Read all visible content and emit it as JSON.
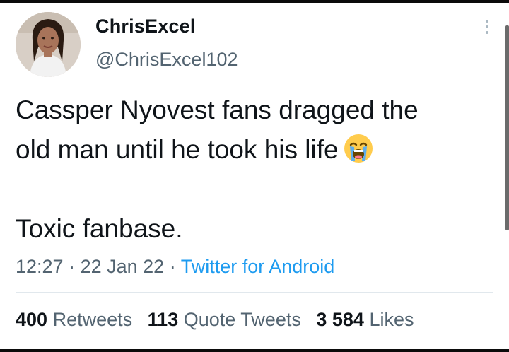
{
  "tweet": {
    "author": {
      "display_name": "ChrisExcel",
      "handle": "@ChrisExcel102"
    },
    "text_line1": "Cassper Nyovest fans dragged the",
    "text_line2": "old man until he took his life",
    "emoji": "loudly-crying-face-icon",
    "text_line3": "Toxic fanbase.",
    "time": "12:27",
    "sep1": " · ",
    "date": "22 Jan 22",
    "sep2": " · ",
    "source": "Twitter for Android"
  },
  "stats": {
    "retweets_count": "400",
    "retweets_label": "Retweets",
    "quotes_count": "113",
    "quotes_label": "Quote Tweets",
    "likes_count": "3 584",
    "likes_label": "Likes"
  },
  "colors": {
    "text": "#0f1419",
    "secondary": "#536471",
    "link": "#1d9bf0"
  }
}
